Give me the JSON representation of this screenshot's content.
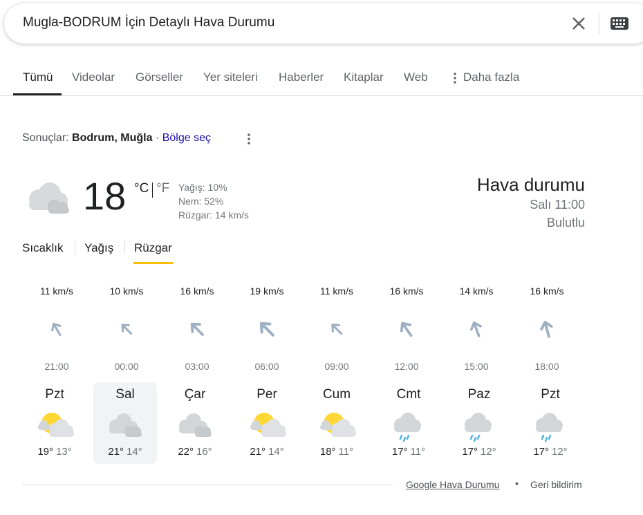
{
  "search": {
    "query": "Mugla-BODRUM İçin Detaylı Hava Durumu"
  },
  "tabs": [
    {
      "label": "Tümü",
      "active": true
    },
    {
      "label": "Videolar"
    },
    {
      "label": "Görseller"
    },
    {
      "label": "Yer siteleri"
    },
    {
      "label": "Haberler"
    },
    {
      "label": "Kitaplar"
    },
    {
      "label": "Web"
    },
    {
      "label": "Daha fazla"
    }
  ],
  "location": {
    "prefix": "Sonuçlar:",
    "place": "Bodrum, Muğla",
    "separator": "·",
    "change_region": "Bölge seç"
  },
  "current": {
    "icon": "cloudy-icon",
    "temperature": "18",
    "unit_c": "°C",
    "unit_f": "°F",
    "precipitation": "Yağış: 10%",
    "humidity": "Nem: 52%",
    "wind": "Rüzgar: 14 km/s",
    "title": "Hava durumu",
    "time": "Salı 11:00",
    "condition": "Bulutlu"
  },
  "subtabs": [
    {
      "label": "Sıcaklık"
    },
    {
      "label": "Yağış"
    },
    {
      "label": "Rüzgar",
      "active": true
    }
  ],
  "wind_forecast": [
    {
      "speed": "11 km/s",
      "time": "21:00",
      "direction_deg": -30,
      "strength": 11
    },
    {
      "speed": "10 km/s",
      "time": "00:00",
      "direction_deg": -45,
      "strength": 10
    },
    {
      "speed": "16 km/s",
      "time": "03:00",
      "direction_deg": -45,
      "strength": 16
    },
    {
      "speed": "19 km/s",
      "time": "06:00",
      "direction_deg": -45,
      "strength": 19
    },
    {
      "speed": "11 km/s",
      "time": "09:00",
      "direction_deg": -45,
      "strength": 11
    },
    {
      "speed": "16 km/s",
      "time": "12:00",
      "direction_deg": -35,
      "strength": 16
    },
    {
      "speed": "14 km/s",
      "time": "15:00",
      "direction_deg": -20,
      "strength": 14
    },
    {
      "speed": "16 km/s",
      "time": "18:00",
      "direction_deg": -15,
      "strength": 16
    }
  ],
  "daily_forecast": [
    {
      "day": "Pzt",
      "icon": "partly-cloudy-icon",
      "high": "19°",
      "low": "13°"
    },
    {
      "day": "Sal",
      "icon": "cloudy-icon",
      "high": "21°",
      "low": "14°",
      "selected": true
    },
    {
      "day": "Çar",
      "icon": "cloudy-icon",
      "high": "22°",
      "low": "16°"
    },
    {
      "day": "Per",
      "icon": "partly-cloudy-icon",
      "high": "21°",
      "low": "14°"
    },
    {
      "day": "Cum",
      "icon": "partly-cloudy-icon",
      "high": "18°",
      "low": "11°"
    },
    {
      "day": "Cmt",
      "icon": "rain-icon",
      "high": "17°",
      "low": "11°"
    },
    {
      "day": "Paz",
      "icon": "rain-icon",
      "high": "17°",
      "low": "12°"
    },
    {
      "day": "Pzt",
      "icon": "rain-icon",
      "high": "17°",
      "low": "12°"
    }
  ],
  "footer": {
    "source": "Google Hava Durumu",
    "dot": "•",
    "feedback": "Geri bildirim"
  },
  "colors": {
    "accent_underline": "#fbbc04",
    "link": "#1a0dab",
    "arrow": "#9fb0c3",
    "sun": "#fdd835",
    "rain": "#4fb3e0"
  }
}
